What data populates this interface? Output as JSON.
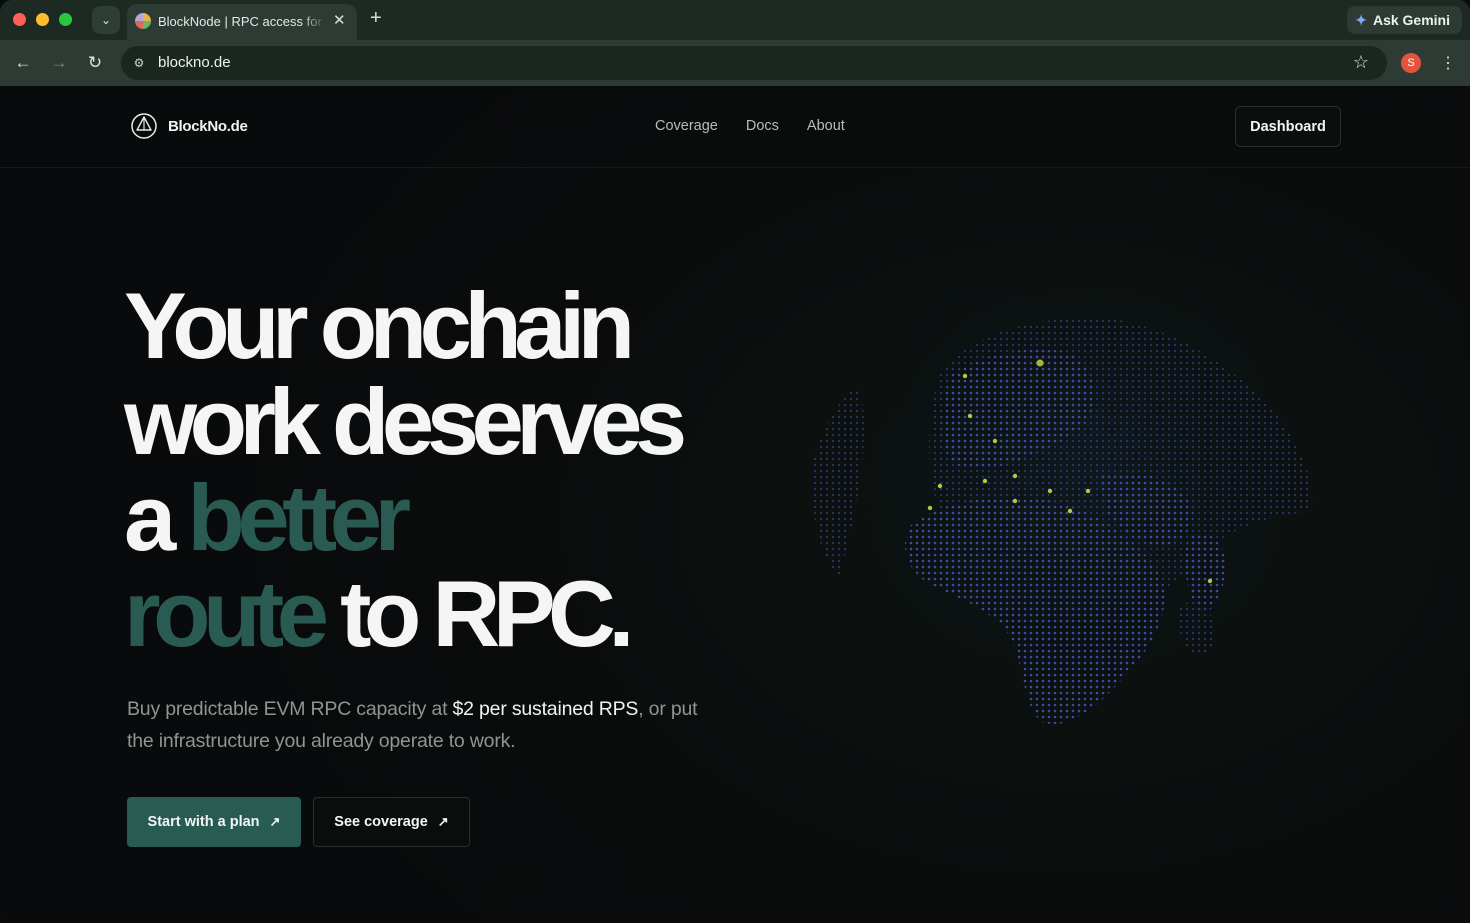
{
  "browser": {
    "tab_title": "BlockNode | RPC access for onchain work",
    "url": "blockno.de",
    "gemini_label": "Ask Gemini",
    "profile_initial": "S",
    "icons": [
      "tab-search-icon",
      "close-icon",
      "plus-icon",
      "back-icon",
      "forward-icon",
      "reload-icon",
      "site-info-icon",
      "star-icon",
      "kebab-menu-icon",
      "gemini-icon"
    ]
  },
  "site": {
    "brand": "BlockNo.de",
    "nav": [
      "Coverage",
      "Docs",
      "About"
    ],
    "dashboard_label": "Dashboard"
  },
  "hero": {
    "line1": "Your onchain",
    "line2": "work deserves",
    "line3_prefix": "a ",
    "line3_accent": "better",
    "line4_accent": "route",
    "line4_suffix": " to RPC.",
    "sub_prefix": "Buy predictable EVM RPC capacity at ",
    "sub_highlight": "$2 per sustained RPS",
    "sub_suffix": ", or put the infrastructure you already operate to work.",
    "cta_primary": "Start with a plan",
    "cta_secondary": "See coverage",
    "accent_color": "#2a5b53"
  },
  "globe": {
    "dot_color": "#3d4ba0",
    "node_color": "#b7c83a"
  }
}
